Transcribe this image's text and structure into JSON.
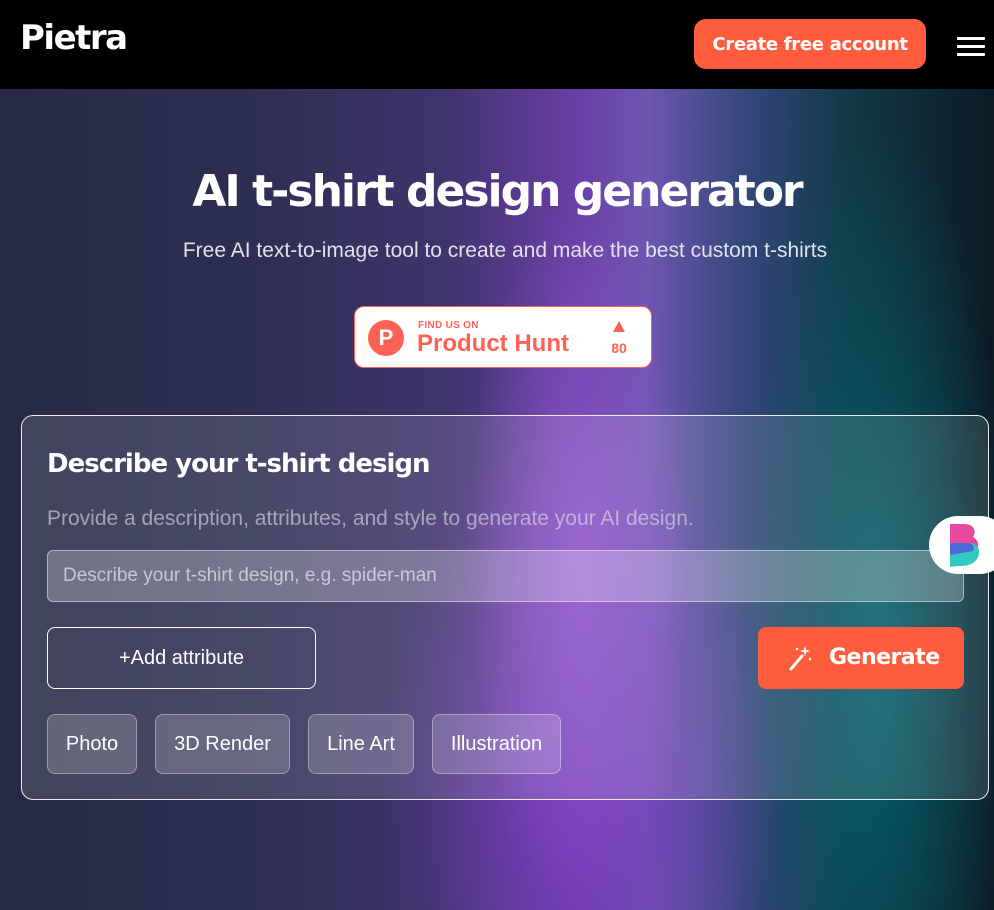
{
  "header": {
    "logo": "Pietra",
    "cta_label": "Create free account",
    "menu_icon": "hamburger-menu-icon"
  },
  "hero": {
    "title": "AI t-shirt design generator",
    "subtitle": "Free AI text-to-image tool to create and make the best custom t-shirts"
  },
  "product_hunt": {
    "logo_letter": "P",
    "small_text": "FIND US ON",
    "name": "Product Hunt",
    "upvotes": "80",
    "arrow_icon": "upvote-arrow-icon",
    "color": "#ff6154"
  },
  "generator": {
    "title": "Describe your t-shirt design",
    "description": "Provide a description, attributes, and style to generate your AI design.",
    "input_placeholder": "Describe your t-shirt design, e.g. spider-man",
    "input_value": "",
    "add_attribute_label": "+Add attribute",
    "generate_label": "Generate",
    "generate_icon": "magic-wand-icon",
    "styles": [
      "Photo",
      "3D Render",
      "Line Art",
      "Illustration"
    ]
  },
  "colors": {
    "accent": "#ff5c3d",
    "header_bg": "#000000",
    "text": "#ffffff"
  },
  "widget": {
    "icon": "assistant-widget-icon"
  }
}
